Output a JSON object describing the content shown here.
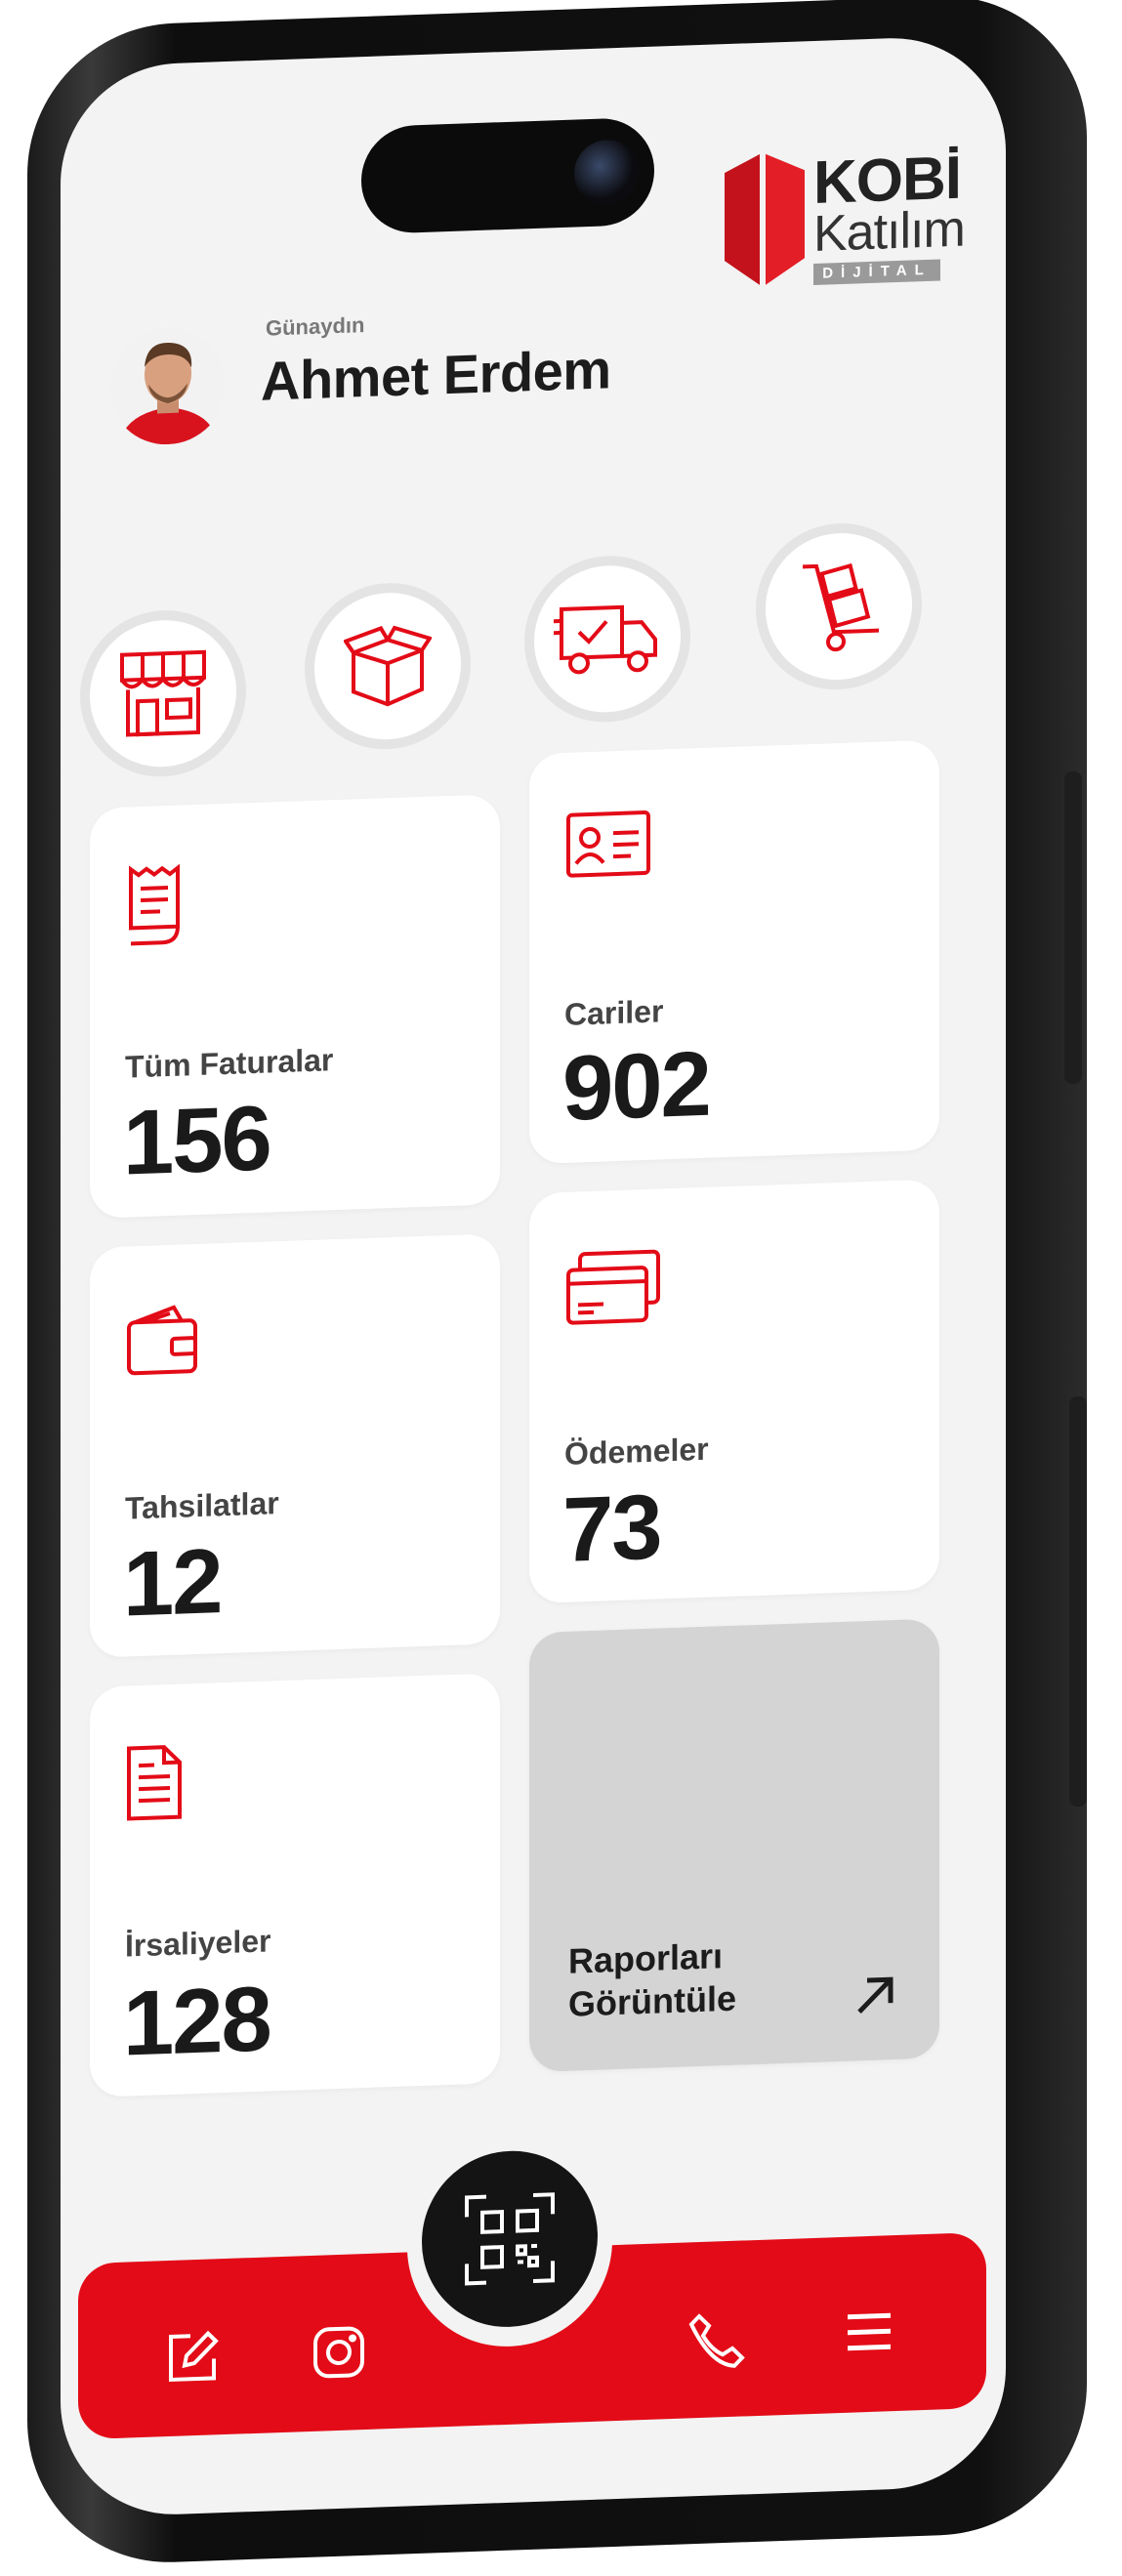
{
  "header": {
    "greeting": "Günaydın",
    "user_name": "Ahmet Erdem"
  },
  "logo": {
    "line1": "KOBİ",
    "line2": "Katılım",
    "line3": "DİJİTAL"
  },
  "quick_actions": [
    {
      "icon": "store-icon"
    },
    {
      "icon": "box-icon"
    },
    {
      "icon": "delivery-truck-icon"
    },
    {
      "icon": "hand-truck-icon"
    }
  ],
  "cards": {
    "invoices": {
      "label": "Tüm Faturalar",
      "value": "156",
      "icon": "receipt-icon"
    },
    "accounts": {
      "label": "Cariler",
      "value": "902",
      "icon": "id-card-icon"
    },
    "collections": {
      "label": "Tahsilatlar",
      "value": "12",
      "icon": "wallet-icon"
    },
    "payments": {
      "label": "Ödemeler",
      "value": "73",
      "icon": "credit-card-icon"
    },
    "waybills": {
      "label": "İrsaliyeler",
      "value": "128",
      "icon": "document-icon"
    },
    "reports": {
      "line1": "Raporları",
      "line2": "Görüntüle",
      "icon": "arrow-up-right-icon"
    }
  },
  "bottom_nav": [
    {
      "icon": "edit-icon"
    },
    {
      "icon": "instagram-icon"
    },
    {
      "icon": "qr-code-icon"
    },
    {
      "icon": "phone-icon"
    },
    {
      "icon": "menu-icon"
    }
  ],
  "colors": {
    "brand_red": "#e30b17",
    "card_bg": "#ffffff",
    "screen_bg": "#f3f3f3",
    "report_bg": "#d4d4d4"
  }
}
